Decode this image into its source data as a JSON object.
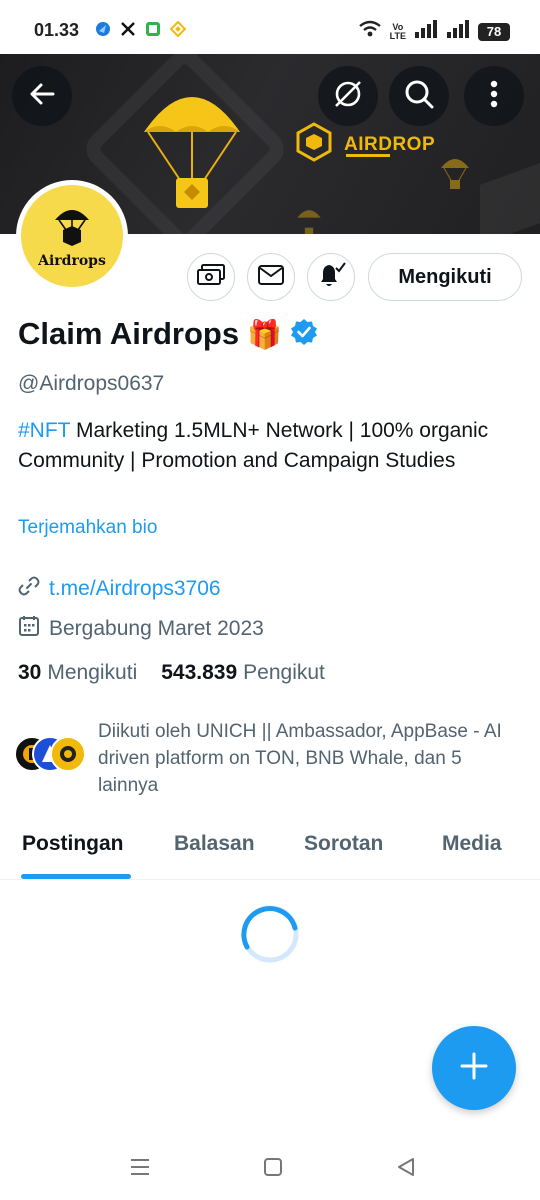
{
  "status": {
    "time": "01.33",
    "volte_top": "Vo",
    "volte_bottom": "LTE",
    "battery": "78"
  },
  "banner": {
    "brand_text": "AIRDROP",
    "accent_color": "#f0b90b"
  },
  "profile": {
    "avatar_label": "Airdrops",
    "display_name": "Claim Airdrops",
    "name_emoji": "🎁",
    "handle": "@Airdrops0637",
    "bio_hashtag": "#NFT",
    "bio_text": " Marketing 1.5MLN+ Network | 100% organic Community | Promotion and Campaign Studies",
    "translate_bio": "Terjemahkan bio",
    "link": "t.me/Airdrops3706",
    "joined": "Bergabung Maret 2023",
    "following_count": "30",
    "following_label": "Mengikuti",
    "followers_count": "543.839",
    "followers_label": "Pengikut",
    "followed_by": "Diikuti oleh UNICH || Ambassador, AppBase - AI driven platform on TON, BNB Whale, dan 5 lainnya"
  },
  "actions": {
    "follow_label": "Mengikuti"
  },
  "tabs": [
    {
      "label": "Postingan"
    },
    {
      "label": "Balasan"
    },
    {
      "label": "Sorotan"
    },
    {
      "label": "Media"
    }
  ],
  "icons": {
    "back": "arrow-left-icon",
    "grok": "grok-icon",
    "search": "search-icon",
    "more": "more-vertical-icon",
    "subscribe": "money-icon",
    "message": "mail-icon",
    "notify": "bell-icon",
    "verified": "verified-badge-icon",
    "link": "link-icon",
    "calendar": "calendar-icon",
    "compose": "plus-icon"
  },
  "colors": {
    "accent": "#1d9bf0",
    "text_primary": "#0f1419",
    "text_secondary": "#536471"
  }
}
